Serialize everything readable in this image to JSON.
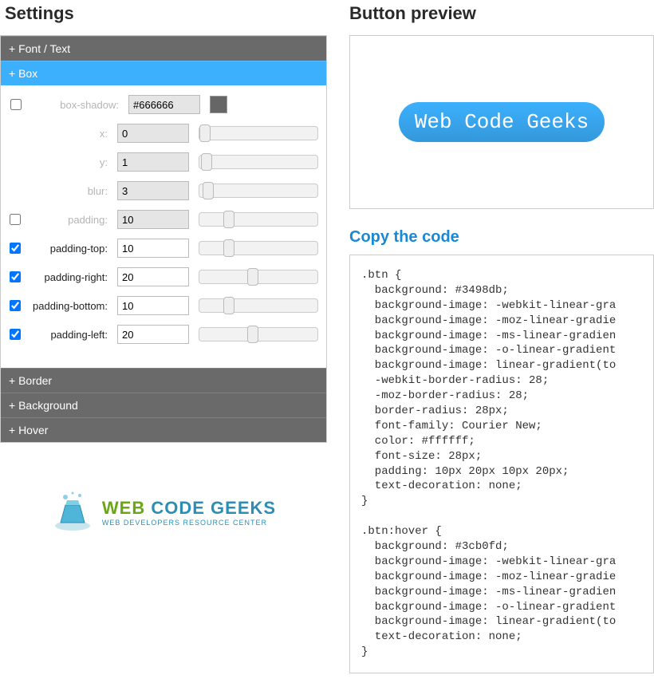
{
  "headings": {
    "settings": "Settings",
    "preview": "Button preview",
    "copy": "Copy the code"
  },
  "accordion": {
    "font": "+ Font / Text",
    "box": "+ Box",
    "border": "+ Border",
    "background": "+ Background",
    "hover": "+ Hover"
  },
  "box": {
    "shadow_label": "box-shadow:",
    "shadow_value": "#666666",
    "shadow_color": "#666666",
    "x_label": "x:",
    "x_value": "0",
    "y_label": "y:",
    "y_value": "1",
    "blur_label": "blur:",
    "blur_value": "3",
    "padding_label": "padding:",
    "padding_value": "10",
    "pt_label": "padding-top:",
    "pt_value": "10",
    "pr_label": "padding-right:",
    "pr_value": "20",
    "pb_label": "padding-bottom:",
    "pb_value": "10",
    "pl_label": "padding-left:",
    "pl_value": "20"
  },
  "button_text": "Web Code Geeks",
  "logo": {
    "main": "WEB CODE GEEKS",
    "sub": "WEB DEVELOPERS RESOURCE CENTER"
  },
  "code": ".btn {\n  background: #3498db;\n  background-image: -webkit-linear-gra\n  background-image: -moz-linear-gradie\n  background-image: -ms-linear-gradien\n  background-image: -o-linear-gradient\n  background-image: linear-gradient(to\n  -webkit-border-radius: 28;\n  -moz-border-radius: 28;\n  border-radius: 28px;\n  font-family: Courier New;\n  color: #ffffff;\n  font-size: 28px;\n  padding: 10px 20px 10px 20px;\n  text-decoration: none;\n}\n\n.btn:hover {\n  background: #3cb0fd;\n  background-image: -webkit-linear-gra\n  background-image: -moz-linear-gradie\n  background-image: -ms-linear-gradien\n  background-image: -o-linear-gradient\n  background-image: linear-gradient(to\n  text-decoration: none;\n}"
}
